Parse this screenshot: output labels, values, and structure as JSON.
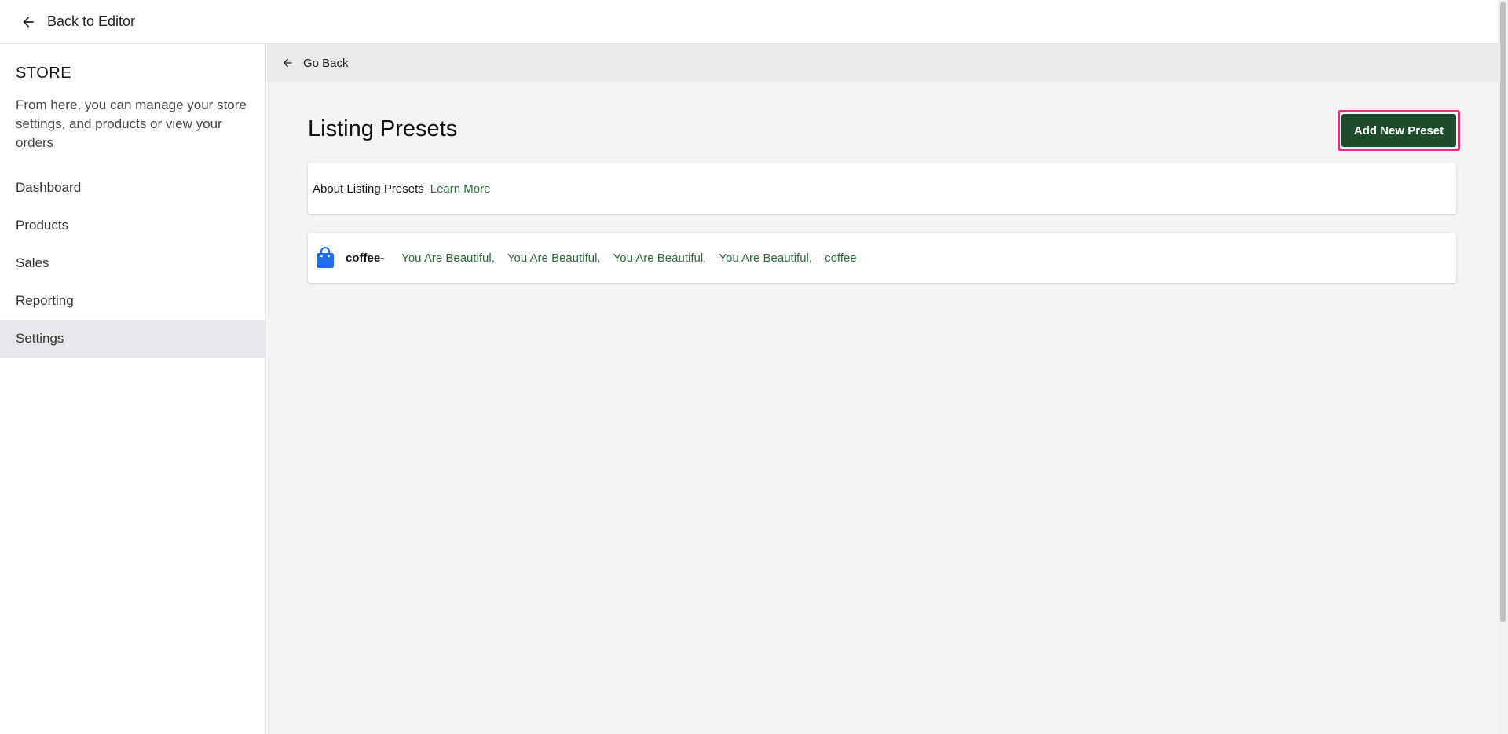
{
  "topbar": {
    "back_label": "Back to Editor"
  },
  "sidebar": {
    "title": "STORE",
    "description": "From here, you can manage your store settings, and products or view your orders",
    "items": [
      {
        "label": "Dashboard",
        "active": false
      },
      {
        "label": "Products",
        "active": false
      },
      {
        "label": "Sales",
        "active": false
      },
      {
        "label": "Reporting",
        "active": false
      },
      {
        "label": "Settings",
        "active": true
      }
    ]
  },
  "main": {
    "go_back_label": "Go Back",
    "page_title": "Listing Presets",
    "add_button_label": "Add New Preset",
    "about": {
      "label": "About Listing Presets",
      "link": "Learn More"
    },
    "presets": [
      {
        "icon": "shopping-bag-icon",
        "name": "coffee-",
        "tags": [
          "You Are Beautiful,",
          "You Are Beautiful,",
          "You Are Beautiful,",
          "You Are Beautiful,",
          "coffee"
        ]
      }
    ]
  },
  "colors": {
    "accent_green": "#1e4d2b",
    "link_green": "#2a6b36",
    "highlight_pink": "#e0307a",
    "bag_blue": "#1e6ee8"
  }
}
